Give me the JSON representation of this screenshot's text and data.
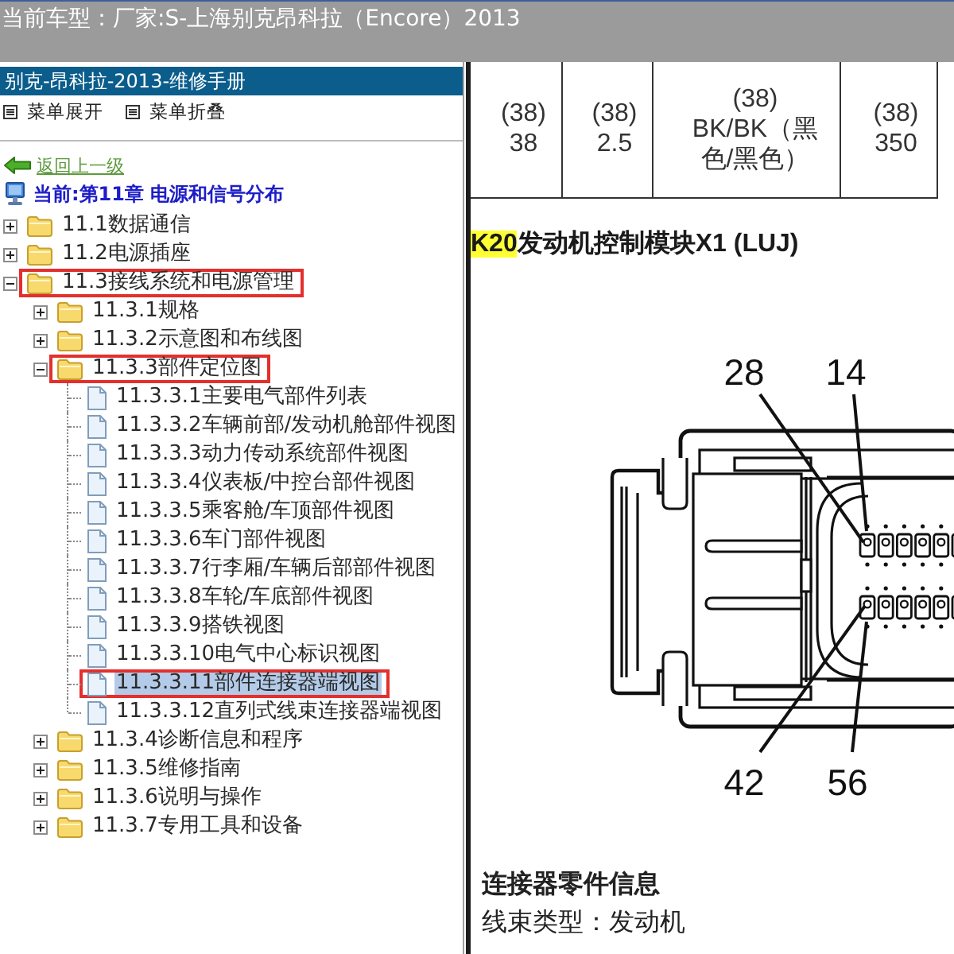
{
  "title_bar": {
    "title": "当前车型：厂家:S-上海别克昂科拉（Encore）2013"
  },
  "sidebar": {
    "title": "别克-昂科拉-2013-维修手册",
    "menu_buttons": [
      "菜单展开",
      "菜单折叠"
    ],
    "back_link": "返回上一级",
    "current": "当前:第11章 电源和信号分布",
    "tree": [
      {
        "label": "11.1数据通信",
        "kind": "folder",
        "expanded": false,
        "selected": false,
        "marked": false
      },
      {
        "label": "11.2电源插座",
        "kind": "folder",
        "expanded": false,
        "selected": false,
        "marked": false
      },
      {
        "label": "11.3接线系统和电源管理",
        "kind": "folder",
        "expanded": true,
        "selected": false,
        "marked": true,
        "children": [
          {
            "label": "11.3.1规格",
            "kind": "folder",
            "expanded": false,
            "selected": false,
            "marked": false
          },
          {
            "label": "11.3.2示意图和布线图",
            "kind": "folder",
            "expanded": false,
            "selected": false,
            "marked": false
          },
          {
            "label": "11.3.3部件定位图",
            "kind": "folder",
            "expanded": true,
            "selected": false,
            "marked": true,
            "children": [
              {
                "label": "11.3.3.1主要电气部件列表",
                "kind": "page",
                "selected": false,
                "marked": false
              },
              {
                "label": "11.3.3.2车辆前部/发动机舱部件视图",
                "kind": "page",
                "selected": false,
                "marked": false
              },
              {
                "label": "11.3.3.3动力传动系统部件视图",
                "kind": "page",
                "selected": false,
                "marked": false
              },
              {
                "label": "11.3.3.4仪表板/中控台部件视图",
                "kind": "page",
                "selected": false,
                "marked": false
              },
              {
                "label": "11.3.3.5乘客舱/车顶部件视图",
                "kind": "page",
                "selected": false,
                "marked": false
              },
              {
                "label": "11.3.3.6车门部件视图",
                "kind": "page",
                "selected": false,
                "marked": false
              },
              {
                "label": "11.3.3.7行李厢/车辆后部部件视图",
                "kind": "page",
                "selected": false,
                "marked": false
              },
              {
                "label": "11.3.3.8车轮/车底部件视图",
                "kind": "page",
                "selected": false,
                "marked": false
              },
              {
                "label": "11.3.3.9搭铁视图",
                "kind": "page",
                "selected": false,
                "marked": false
              },
              {
                "label": "11.3.3.10电气中心标识视图",
                "kind": "page",
                "selected": false,
                "marked": false
              },
              {
                "label": "11.3.3.11部件连接器端视图",
                "kind": "page",
                "selected": true,
                "marked": true
              },
              {
                "label": "11.3.3.12直列式线束连接器端视图",
                "kind": "page",
                "selected": false,
                "marked": false
              }
            ]
          },
          {
            "label": "11.3.4诊断信息和程序",
            "kind": "folder",
            "expanded": false,
            "selected": false,
            "marked": false
          },
          {
            "label": "11.3.5维修指南",
            "kind": "folder",
            "expanded": false,
            "selected": false,
            "marked": false
          },
          {
            "label": "11.3.6说明与操作",
            "kind": "folder",
            "expanded": false,
            "selected": false,
            "marked": false
          },
          {
            "label": "11.3.7专用工具和设备",
            "kind": "folder",
            "expanded": false,
            "selected": false,
            "marked": false
          }
        ]
      }
    ]
  },
  "content": {
    "table": {
      "rows": [
        {
          "cells": [
            "(38)\n38",
            "(38)\n2.5",
            "(38)\nBK/BK（黑色/黑色）",
            "(38)\n350"
          ]
        }
      ]
    },
    "heading": {
      "code": "K20",
      "code_highlighted": true,
      "title": "发动机控制模块X1 (LUJ)"
    },
    "diagram": {
      "pin_labels": [
        "28",
        "14",
        "42",
        "56"
      ]
    },
    "connector_info": {
      "title": "连接器零件信息",
      "lines": [
        "线束类型：发动机"
      ]
    }
  }
}
